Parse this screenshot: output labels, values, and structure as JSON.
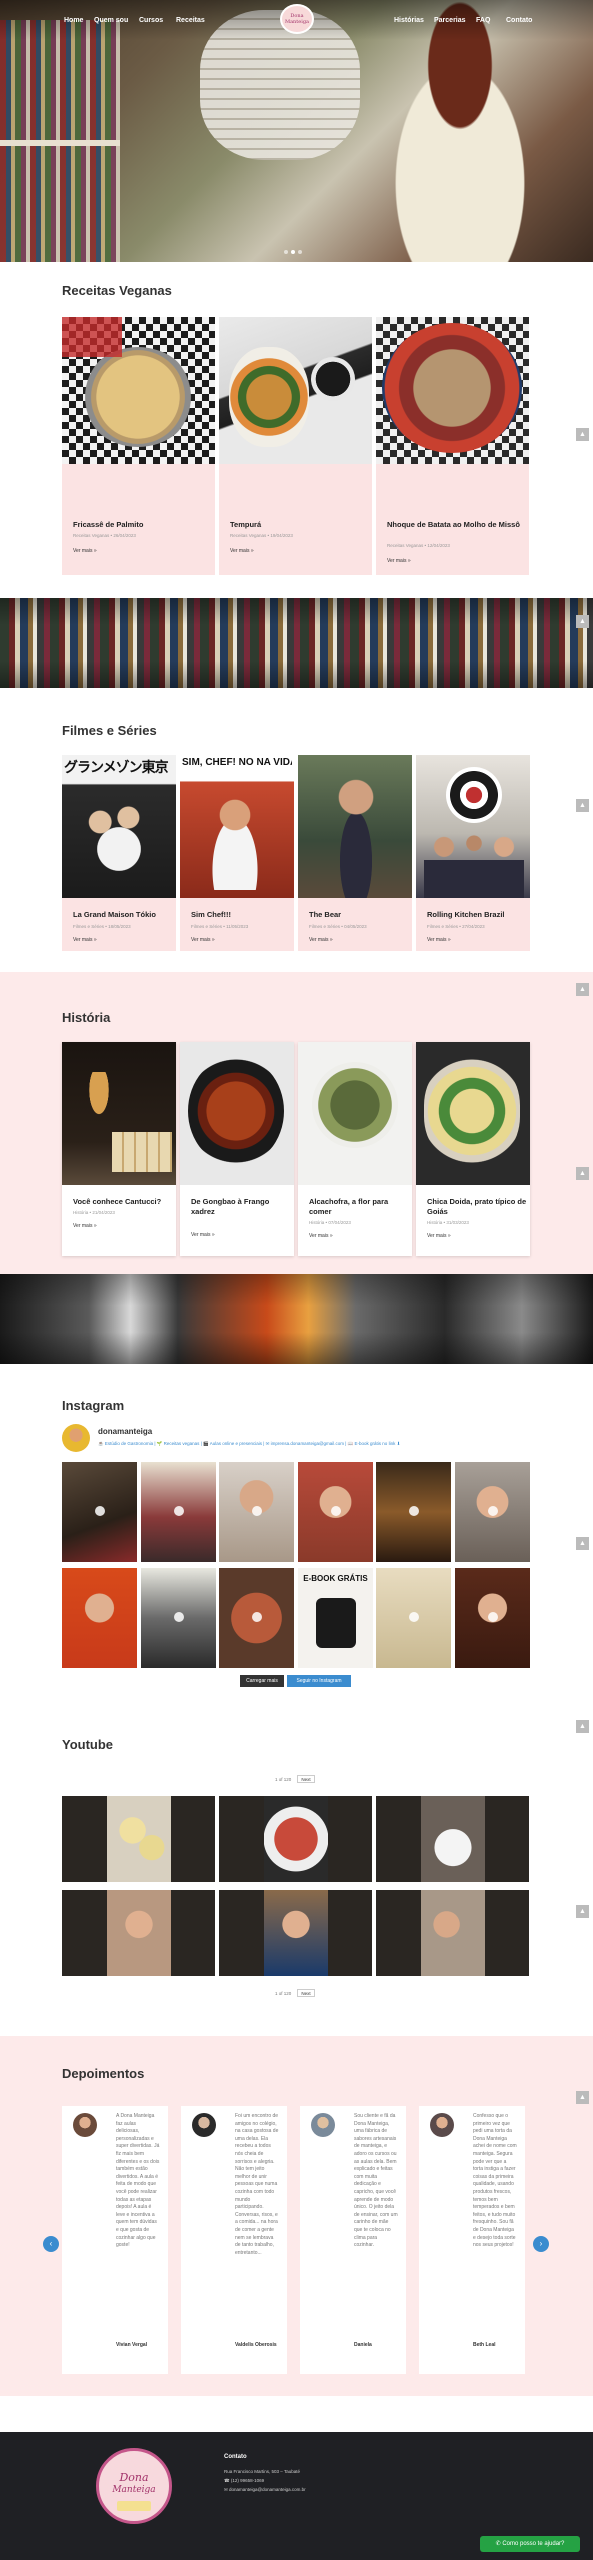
{
  "nav": {
    "left": [
      "Home",
      "Quem sou",
      "Cursos",
      "Receitas"
    ],
    "right": [
      "Histórias",
      "Parcerias",
      "FAQ",
      "Contato"
    ],
    "logo_text": "Dona Manteiga"
  },
  "sections": {
    "receitas_title": "Receitas Veganas",
    "filmes_title": "Filmes e Séries",
    "historia_title": "História",
    "instagram_title": "Instagram",
    "youtube_title": "Youtube",
    "depoimentos_title": "Depoimentos"
  },
  "receitas": [
    {
      "title": "Fricassê de Palmito",
      "meta": "Receitas Veganas • 26/04/2023",
      "more": "Ver mais »"
    },
    {
      "title": "Tempurá",
      "meta": "Receitas Veganas • 19/04/2023",
      "more": "Ver mais »"
    },
    {
      "title": "Nhoque de Batata ao Molho de Missô",
      "meta": "Receitas Veganas • 12/04/2023",
      "more": "Ver mais »"
    }
  ],
  "filmes": [
    {
      "title": "La Grand Maison Tókio",
      "meta": "Filmes e Séries • 18/05/2023",
      "more": "Ver mais »",
      "poster_text": "グランメゾン東京"
    },
    {
      "title": "Sim Chef!!!",
      "meta": "Filmes e Séries • 11/05/2023",
      "more": "Ver mais »",
      "poster_text": "SIM, CHEF! NO NA VIDA DE UM"
    },
    {
      "title": "The Bear",
      "meta": "Filmes e Séries • 04/05/2023",
      "more": "Ver mais »"
    },
    {
      "title": "Rolling Kitchen Brazil",
      "meta": "Filmes e Séries • 27/04/2023",
      "more": "Ver mais »"
    }
  ],
  "historia": [
    {
      "title": "Você conhece Cantucci?",
      "meta": "História • 21/04/2023",
      "more": "Ver mais »"
    },
    {
      "title": "De Gongbao à Frango xadrez",
      "meta": "História • 14/04/2023",
      "more": "Ver mais »"
    },
    {
      "title": "Alcachofra, a flor para comer",
      "meta": "História • 07/04/2023",
      "more": "Ver mais »"
    },
    {
      "title": "Chica Doida, prato típico de Goiás",
      "meta": "História • 31/03/2023",
      "more": "Ver mais »"
    }
  ],
  "instagram": {
    "handle": "donamanteiga",
    "bio": "☕ Estúdio de Gastronomia | 🌱 Receitas veganas | 🎬 Aulas online e presenciais | ✉ imprensa.donamanteiga@gmail.com | 📖 E-book grátis no link ⬇",
    "load_more": "Carregar mais",
    "follow": "Seguir no Instagram",
    "ebook_text": "E-BOOK GRÁTIS"
  },
  "youtube": {
    "pager_top": "1 of 120",
    "next_top": "Next",
    "pager_bottom": "1 of 120",
    "next_bottom": "Next"
  },
  "depoimentos": [
    {
      "text": "A Dona Manteiga faz aulas deliciosas, personalizadas e super divertidas. Já fiz mais bem diferentes e os dois também estão divertidos. A aula é feita de modo que você pode realizar todas as etapas depois! A aula é leve e incentiva a quem tem dúvidas e que gosta de cozinhar algo que goste!",
      "name": "Vivian Vergal"
    },
    {
      "text": "Foi um encontro de amigos no colégio, na casa gostosa de uma delas. Ela recebeu a todos nós cheia de sorrisos e alegria. Não tem jeito melhor de unir pessoas que numa cozinha com todo mundo participando. Conversas, risos, e a comida... na hora de comer a gente nem se lembrava de tanto trabalho, entretanto...",
      "name": "Valdelis Oberosis"
    },
    {
      "text": "Sou cliente e fã da Dona Manteiga, uma fábrica de sabores artesanais de manteiga, e adoro os cursos ou as aulas dela. Bem explicado e feitas com muita dedicação e capricho, que você aprende de modo único. O jeito dela de ensinar, com um carinho de mãe que te coloca no clima para cozinhar.",
      "name": "Daniela"
    },
    {
      "text": "Confesso que o primeiro vez que pedi uma torta da Dona Manteiga achei de nome com manteiga. Segura pode ver que a torta instiga a fazer coisas da primeira qualidade, usando produtos frescos, temos bem temperados e bem feitos, e tudo muito fresquinho. Sou fã de Dona Manteiga e desejo toda sorte nos seus projetos!",
      "name": "Beth Leal"
    }
  ],
  "footer": {
    "contact_title": "Contato",
    "address": "Rua Francisco Martins, 503 – Taubaté",
    "phone": "(12) 99658-1069",
    "email": "donamanteiga@donamanteiga.com.br",
    "logo_line1": "Dona",
    "logo_line2": "Manteiga",
    "whatsapp": "Como posso te ajudar?"
  }
}
